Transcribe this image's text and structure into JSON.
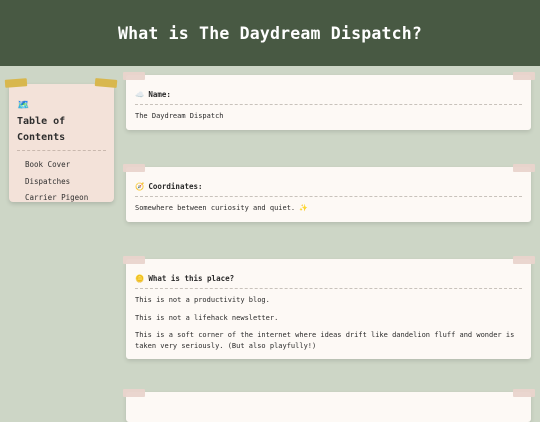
{
  "header": {
    "title": "What is The Daydream Dispatch?"
  },
  "toc": {
    "icon": "🗺️",
    "title": "Table of Contents",
    "items": [
      "Book Cover",
      "Dispatches",
      "Carrier Pigeon"
    ]
  },
  "cards": [
    {
      "icon": "☁️",
      "label": "Name:",
      "paragraphs": [
        "The Daydream Dispatch"
      ]
    },
    {
      "icon": "🧭",
      "label": "Coordinates:",
      "paragraphs": [
        "Somewhere between curiosity and quiet. ✨"
      ]
    },
    {
      "icon": "🪙",
      "label": "What is this place?",
      "paragraphs": [
        "This is not a productivity blog.",
        "This is not a lifehack newsletter.",
        "This is a soft corner of the internet where ideas drift like dandelion fluff and wonder is taken very seriously. (But also playfully!)"
      ]
    }
  ],
  "colors": {
    "header_bg": "#485943",
    "page_bg": "#cdd6c6",
    "toc_bg": "#f3e2d9",
    "card_bg": "#fdf9f5",
    "tape_yellow": "#d8b74e",
    "tape_pink": "#e9d4cc"
  }
}
